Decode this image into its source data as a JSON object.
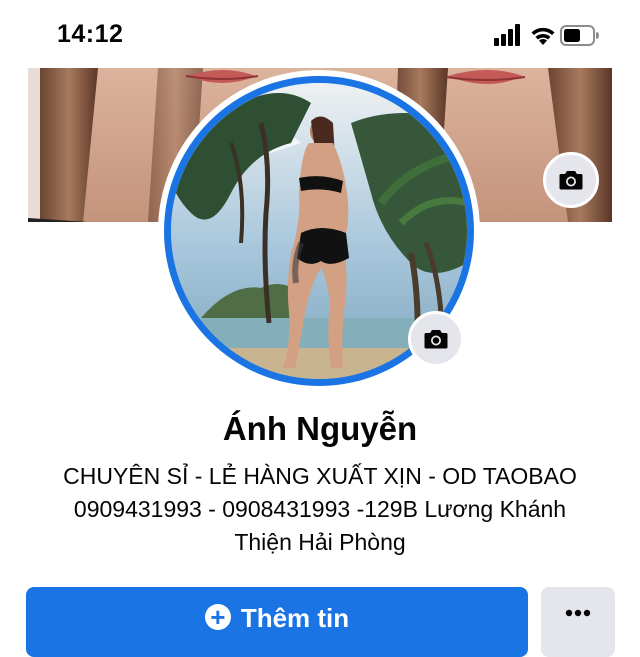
{
  "status_bar": {
    "time": "14:12"
  },
  "profile": {
    "name": "Ánh Nguyễn",
    "bio_lines": [
      "CHUYÊN SỈ - LẺ HÀNG XUẤT XỊN - OD TAOBAO",
      "0909431993 - 0908431993 -129B Lương Khánh",
      "Thiện Hải Phòng"
    ]
  },
  "actions": {
    "add_info_label": "Thêm tin",
    "more_label": "•••"
  },
  "icons": {
    "cover_camera": "camera-icon",
    "avatar_camera": "camera-icon",
    "add": "plus-circle-icon",
    "more": "ellipsis-icon"
  },
  "colors": {
    "accent": "#1b74e4",
    "secondary_button": "#e4e6eb",
    "text": "#050505"
  }
}
